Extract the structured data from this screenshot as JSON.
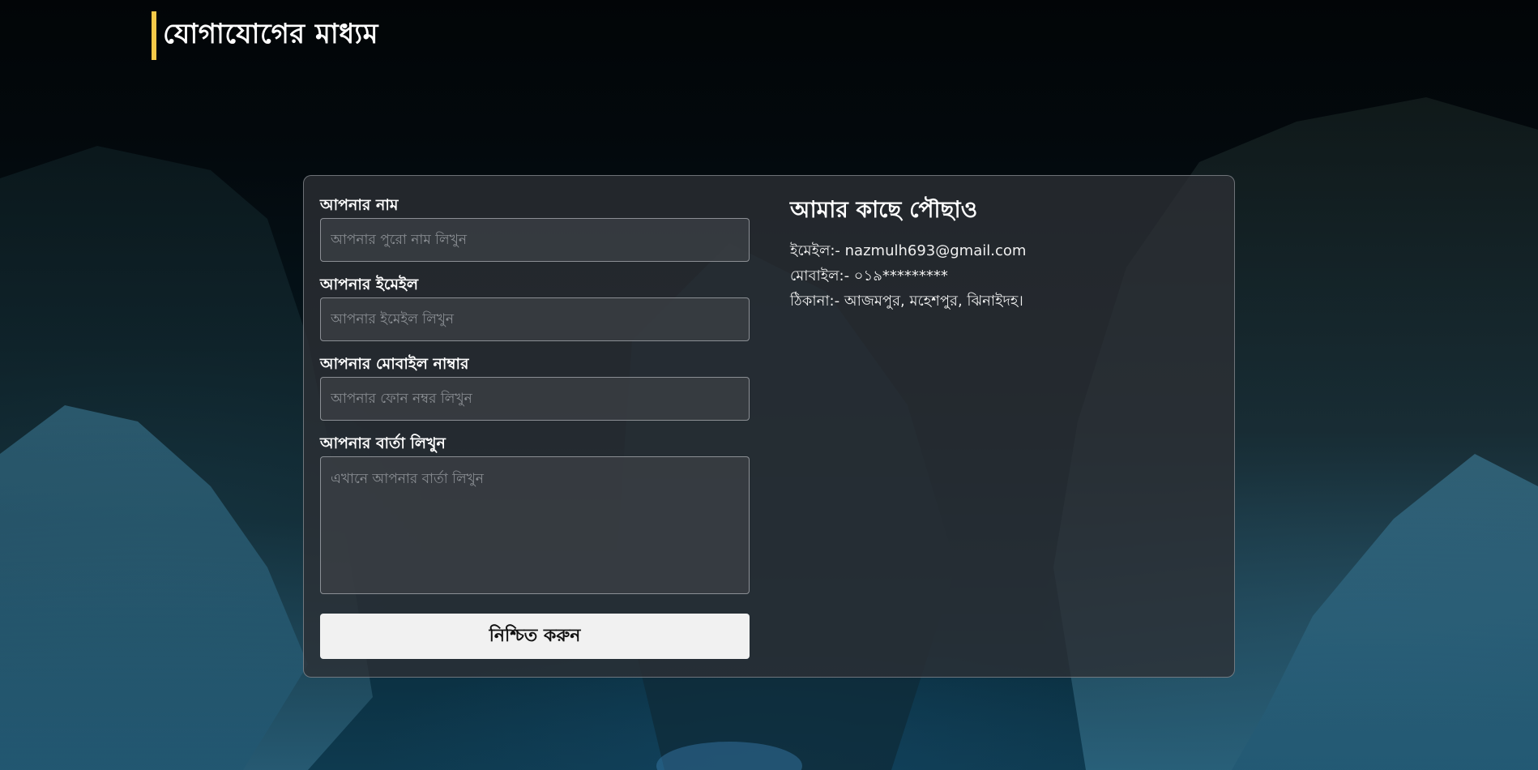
{
  "page": {
    "heading": "যোগাযোগের মাধ্যম",
    "accent_color": "#f7c948"
  },
  "form": {
    "name_label": "আপনার নাম",
    "name_placeholder": "আপনার পুরো নাম লিখুন",
    "email_label": "আপনার ইমেইল",
    "email_placeholder": "আপনার ইমেইল লিখুন",
    "mobile_label": "আপনার মোবাইল নাম্বার",
    "mobile_placeholder": "আপনার ফোন নম্বর লিখুন",
    "message_label": "আপনার বার্তা লিখুন",
    "message_placeholder": "এখানে আপনার বার্তা লিখুন",
    "submit_label": "নিশ্চিত করুন"
  },
  "contact": {
    "title": "আমার কাছে পৌছাও",
    "email": "ইমেইল:- nazmulh693@gmail.com",
    "mobile": "মোবাইল:- ০১৯*********",
    "address": "ঠিকানা:- আজমপুর, মহেশপুর, ঝিনাইদহ।"
  }
}
